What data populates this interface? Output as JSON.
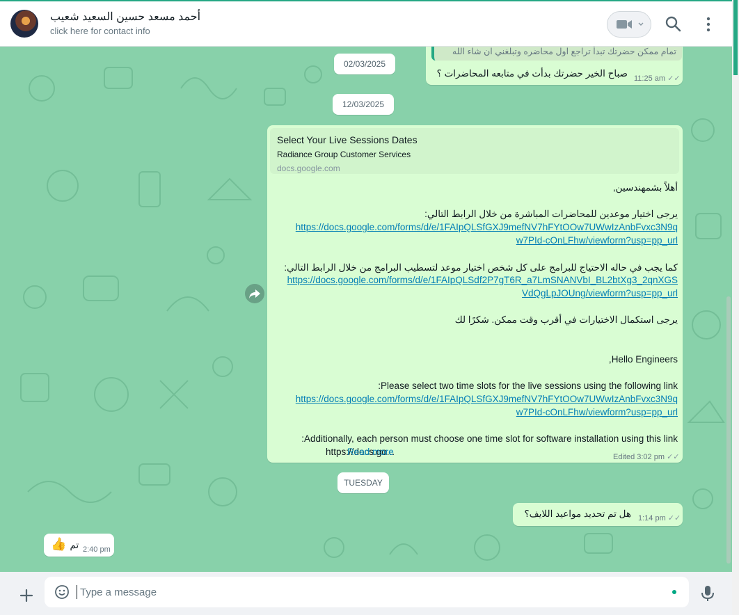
{
  "header": {
    "contact_name": "أحمد مسعد حسين السعيد شعيب",
    "subtitle": "click here for contact info"
  },
  "messages": {
    "top_quote": "تمام ممكن حضرتك تبدأ تراجع اول محاضره وتبلغني ان شاء الله",
    "msg1_text": "صباح الخير حضرتك بدأت في متابعه المحاضرات ؟",
    "msg1_time": "11:25 am",
    "date1": "02/03/2025",
    "date2": "12/03/2025",
    "preview_title": "Select Your Live Sessions Dates",
    "preview_desc": "Radiance Group Customer Services",
    "preview_domain": "docs.google.com",
    "ar_greeting": "أهلاً بشمهندسين,",
    "ar_line1": "يرجى اختيار موعدين للمحاضرات المباشرة من خلال الرابط التالي:",
    "link1_a": "https://docs.google.com/forms/d/e/1FAIpQLSfGXJ9mefNV7hFYtOOw7UWwIzAnbFvxc3N9q",
    "link1_b": "w7PId-cOnLFhw/viewform?usp=pp_url",
    "ar_line2": "كما يجب في حاله الاحتياج للبرامج على كل شخص اختيار موعد لتسطيب  البرامج من خلال الرابط التالي:",
    "link2_a": "https://docs.google.com/forms/d/e/1FAIpQLSdf2P7gT6R_a7LmSNANVbI_BL2btXg3_2qnXGS",
    "link2_b": "VdQgLpJOUng/viewform?usp=pp_url",
    "ar_line3": "يرجى استكمال الاختيارات في أقرب وقت ممكن. شكرًا لك",
    "en_greeting": "Hello Engineers,",
    "en_line1": "Please select two time slots for the live sessions using the following link:",
    "link3_a": "https://docs.google.com/forms/d/e/1FAIpQLSfGXJ9mefNV7hFYtOOw7UWwIzAnbFvxc3N9q",
    "link3_b": "w7PId-cOnLFhw/viewform?usp=pp_url",
    "en_line2": "Additionally, each person must choose one time slot for software installation using this link:",
    "en_trunc": "https://docs.go...",
    "read_more": "Read more",
    "msg2_time": "Edited 3:02 pm",
    "date3": "TUESDAY",
    "msg3_text": "هل تم تحديد مواعيد اللايف؟",
    "msg3_time": "1:14 pm",
    "msg4_text": "تم",
    "msg4_emoji": "👍",
    "msg4_time": "2:40 pm"
  },
  "composer": {
    "placeholder": "Type a message"
  },
  "icons": [
    "video-call-icon",
    "chevron-down-icon",
    "search-icon",
    "menu-icon",
    "forward-icon",
    "plus-icon",
    "sticker-icon",
    "microphone-icon",
    "read-ticks-icon"
  ],
  "colors": {
    "chat_bg": "#88d1aa",
    "outgoing_bubble": "#d9fdd3",
    "incoming_bubble": "#ffffff",
    "link": "#027eb5",
    "accent": "#25a884"
  }
}
